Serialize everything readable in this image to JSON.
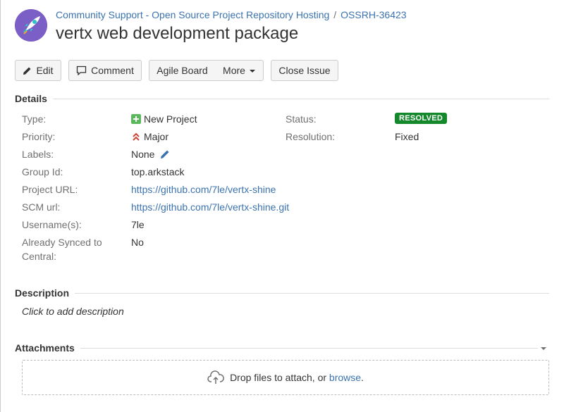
{
  "breadcrumb": {
    "project": "Community Support - Open Source Project Repository Hosting",
    "separator": "/",
    "issue_key": "OSSRH-36423"
  },
  "issue": {
    "title": "vertx web development package"
  },
  "toolbar": {
    "edit": "Edit",
    "comment": "Comment",
    "agile_board": "Agile Board",
    "more": "More",
    "close_issue": "Close Issue"
  },
  "details": {
    "heading": "Details",
    "type": {
      "label": "Type:",
      "value": "New Project"
    },
    "priority": {
      "label": "Priority:",
      "value": "Major"
    },
    "labels": {
      "label": "Labels:",
      "value": "None"
    },
    "group_id": {
      "label": "Group Id:",
      "value": "top.arkstack"
    },
    "project_url": {
      "label": "Project URL:",
      "value": "https://github.com/7le/vertx-shine"
    },
    "scm_url": {
      "label": "SCM url:",
      "value": "https://github.com/7le/vertx-shine.git"
    },
    "usernames": {
      "label": "Username(s):",
      "value": "7le"
    },
    "synced": {
      "label_line1": "Already Synced to",
      "label_line2": "Central:",
      "value": "No"
    },
    "status": {
      "label": "Status:",
      "value": "RESOLVED"
    },
    "resolution": {
      "label": "Resolution:",
      "value": "Fixed"
    }
  },
  "description": {
    "heading": "Description",
    "placeholder": "Click to add description"
  },
  "attachments": {
    "heading": "Attachments",
    "drop_text": "Drop files to attach, or ",
    "browse": "browse",
    "period": "."
  },
  "colors": {
    "link": "#3b73af",
    "resolved_badge": "#14892c",
    "avatar": "#7b5ec6",
    "new_project_icon": "#5cb85c",
    "priority_major": "#d04437"
  },
  "icons": {
    "edit": "pencil-icon",
    "comment": "comment-icon",
    "type": "plus-square-icon",
    "priority": "double-chevron-up-icon",
    "labels_edit": "pencil-icon",
    "upload": "cloud-upload-icon",
    "section_toggle": "chevron-down-icon"
  }
}
